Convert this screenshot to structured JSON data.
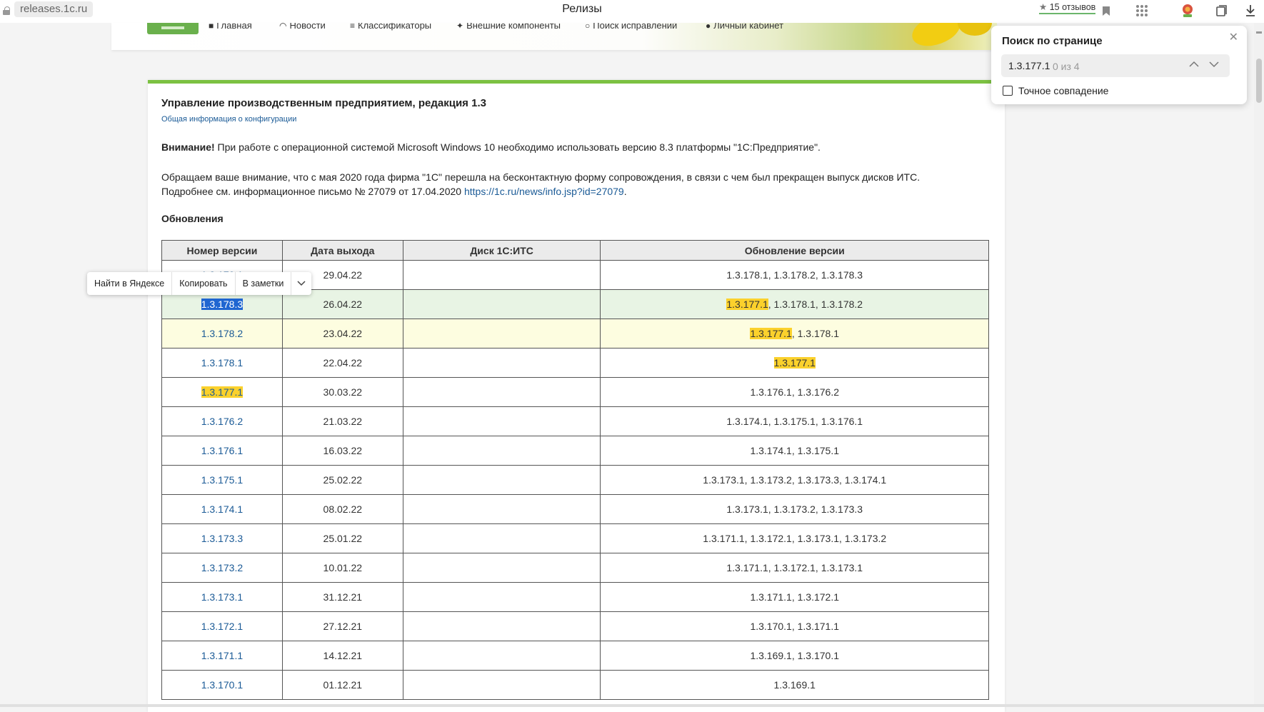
{
  "browser": {
    "url": "releases.1c.ru",
    "window_title": "Релизы",
    "reviews_label": "15 отзывов"
  },
  "nav": {
    "items": [
      "Главная",
      "Новости",
      "Классификаторы",
      "Внешние компоненты",
      "Поиск исправлений",
      "Личный кабинет"
    ]
  },
  "page": {
    "title": "Управление производственным предприятием, редакция 1.3",
    "subtitle_link": "Общая информация о конфигурации",
    "warning_bold": "Внимание!",
    "warning_text": " При работе с операционной системой Microsoft Windows 10 необходимо использовать версию 8.3 платформы \"1С:Предприятие\".",
    "notice_line1": "Обращаем ваше внимание, что с мая 2020 года фирма \"1С\" перешла на бесконтактную форму сопровождения, в связи с чем был прекращен выпуск дисков ИТС.",
    "notice_line2_prefix": "Подробнее см. информационное письмо № 27079 от 17.04.2020 ",
    "notice_link": "https://1c.ru/news/info.jsp?id=27079",
    "notice_suffix": ".",
    "updates_heading": "Обновления"
  },
  "table": {
    "headers": [
      "Номер версии",
      "Дата выхода",
      "Диск 1С:ИТС",
      "Обновление версии"
    ],
    "rows": [
      {
        "version": "1.3.179.1",
        "date": "29.04.22",
        "disk": "",
        "update_prefix": "",
        "update_hl": "",
        "update_rest": "1.3.178.1, 1.3.178.2, 1.3.178.3"
      },
      {
        "version": "1.3.178.3",
        "date": "26.04.22",
        "disk": "",
        "update_prefix": "",
        "update_hl": "1.3.177.1",
        "update_rest": ", 1.3.178.1, 1.3.178.2"
      },
      {
        "version": "1.3.178.2",
        "date": "23.04.22",
        "disk": "",
        "update_prefix": "",
        "update_hl": "1.3.177.1",
        "update_rest": ", 1.3.178.1"
      },
      {
        "version": "1.3.178.1",
        "date": "22.04.22",
        "disk": "",
        "update_prefix": "",
        "update_hl": "1.3.177.1",
        "update_rest": ""
      },
      {
        "version": "1.3.177.1",
        "date": "30.03.22",
        "disk": "",
        "update_prefix": "",
        "update_hl": "",
        "update_rest": "1.3.176.1, 1.3.176.2"
      },
      {
        "version": "1.3.176.2",
        "date": "21.03.22",
        "disk": "",
        "update_prefix": "",
        "update_hl": "",
        "update_rest": "1.3.174.1, 1.3.175.1, 1.3.176.1"
      },
      {
        "version": "1.3.176.1",
        "date": "16.03.22",
        "disk": "",
        "update_prefix": "",
        "update_hl": "",
        "update_rest": "1.3.174.1, 1.3.175.1"
      },
      {
        "version": "1.3.175.1",
        "date": "25.02.22",
        "disk": "",
        "update_prefix": "",
        "update_hl": "",
        "update_rest": "1.3.173.1, 1.3.173.2, 1.3.173.3, 1.3.174.1"
      },
      {
        "version": "1.3.174.1",
        "date": "08.02.22",
        "disk": "",
        "update_prefix": "",
        "update_hl": "",
        "update_rest": "1.3.173.1, 1.3.173.2, 1.3.173.3"
      },
      {
        "version": "1.3.173.3",
        "date": "25.01.22",
        "disk": "",
        "update_prefix": "",
        "update_hl": "",
        "update_rest": "1.3.171.1, 1.3.172.1, 1.3.173.1, 1.3.173.2"
      },
      {
        "version": "1.3.173.2",
        "date": "10.01.22",
        "disk": "",
        "update_prefix": "",
        "update_hl": "",
        "update_rest": "1.3.171.1, 1.3.172.1, 1.3.173.1"
      },
      {
        "version": "1.3.173.1",
        "date": "31.12.21",
        "disk": "",
        "update_prefix": "",
        "update_hl": "",
        "update_rest": "1.3.171.1, 1.3.172.1"
      },
      {
        "version": "1.3.172.1",
        "date": "27.12.21",
        "disk": "",
        "update_prefix": "",
        "update_hl": "",
        "update_rest": "1.3.170.1, 1.3.171.1"
      },
      {
        "version": "1.3.171.1",
        "date": "14.12.21",
        "disk": "",
        "update_prefix": "",
        "update_hl": "",
        "update_rest": "1.3.169.1, 1.3.170.1"
      },
      {
        "version": "1.3.170.1",
        "date": "01.12.21",
        "disk": "",
        "update_prefix": "",
        "update_hl": "",
        "update_rest": "1.3.169.1"
      }
    ]
  },
  "find_panel": {
    "title": "Поиск по странице",
    "query": "1.3.177.1",
    "count": "0 из 4",
    "exact_match_label": "Точное совпадение"
  },
  "context_menu": {
    "items": [
      "Найти в Яндексе",
      "Копировать",
      "В заметки"
    ]
  },
  "colors": {
    "accent_green": "#7cc142",
    "link_blue": "#1a5a96",
    "highlight_yellow": "#fbd12c",
    "selection_blue": "#1f66d1"
  }
}
